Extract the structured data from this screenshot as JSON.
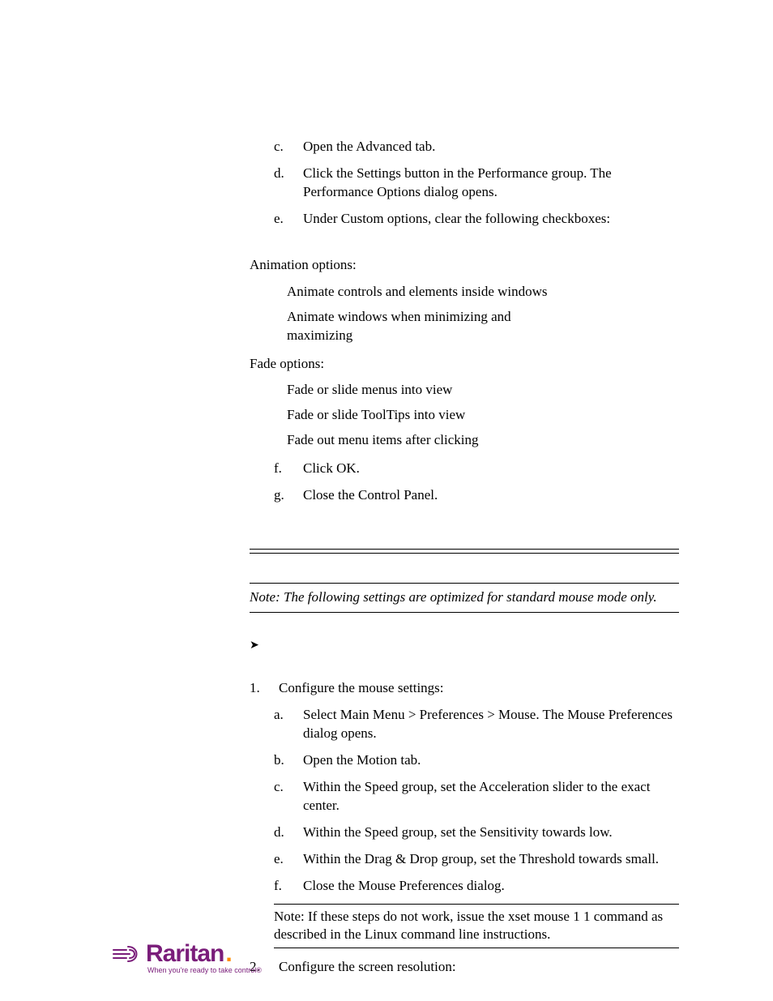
{
  "top_letters": [
    {
      "marker": "c.",
      "text": "Open the Advanced tab."
    },
    {
      "marker": "d.",
      "text": "Click the Settings button in the Performance group. The Performance Options dialog opens."
    },
    {
      "marker": "e.",
      "text": "Under Custom options, clear the following checkboxes:"
    }
  ],
  "anim_header": "Animation options:",
  "anim_items": [
    "Animate controls and elements inside windows",
    "Animate windows when minimizing and maximizing"
  ],
  "fade_header": "Fade options:",
  "fade_items": [
    "Fade or slide menus into view",
    "Fade or slide ToolTips into view",
    "Fade out menu items after clicking"
  ],
  "mid_letters": [
    {
      "marker": "f.",
      "text": "Click OK."
    },
    {
      "marker": "g.",
      "text": "Close the Control Panel."
    }
  ],
  "note1": "Note: The following settings are optimized for standard mouse mode only.",
  "numbered": [
    {
      "marker": "1.",
      "text": "Configure the mouse settings:",
      "sub": [
        {
          "marker": "a.",
          "text": "Select Main Menu > Preferences > Mouse. The Mouse Preferences dialog opens."
        },
        {
          "marker": "b.",
          "text": "Open the Motion tab."
        },
        {
          "marker": "c.",
          "text": "Within the Speed group, set the Acceleration slider to the exact center."
        },
        {
          "marker": "d.",
          "text": "Within the Speed group, set the Sensitivity towards low."
        },
        {
          "marker": "e.",
          "text": "Within the Drag & Drop group, set the Threshold towards small."
        },
        {
          "marker": "f.",
          "text": "Close the Mouse Preferences dialog."
        }
      ],
      "subnote": "Note: If these steps do not work, issue the xset mouse 1 1 command as described in the Linux command line instructions."
    },
    {
      "marker": "2.",
      "text": "Configure the screen resolution:"
    }
  ],
  "logo": {
    "word": "Raritan",
    "tagline": "When you're ready to take control®"
  }
}
